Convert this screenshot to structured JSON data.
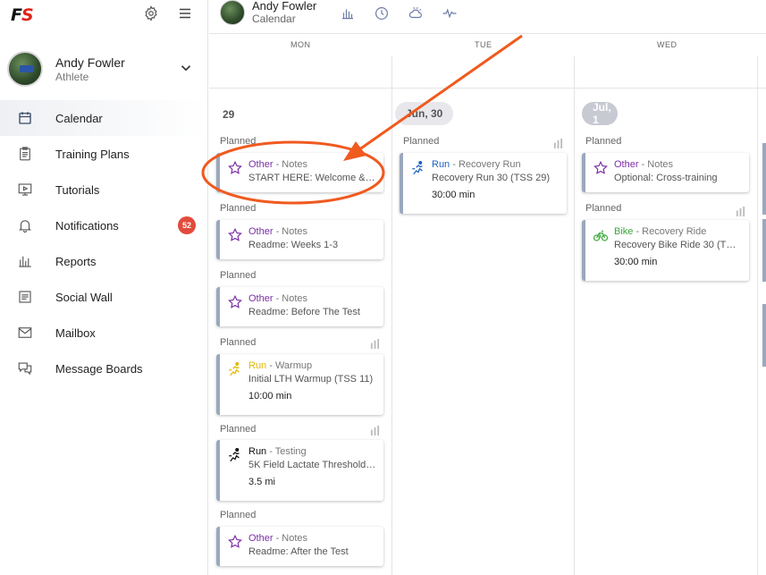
{
  "app": {
    "logo_f": "F",
    "logo_s": "S"
  },
  "profile": {
    "name": "Andy Fowler",
    "role": "Athlete"
  },
  "header": {
    "name": "Andy Fowler",
    "subtitle": "Calendar"
  },
  "nav": [
    {
      "label": "Calendar",
      "icon": "calendar-icon",
      "active": true
    },
    {
      "label": "Training Plans",
      "icon": "clipboard-icon"
    },
    {
      "label": "Tutorials",
      "icon": "video-icon"
    },
    {
      "label": "Notifications",
      "icon": "bell-icon",
      "badge": "52"
    },
    {
      "label": "Reports",
      "icon": "bar-chart-icon"
    },
    {
      "label": "Social Wall",
      "icon": "wall-icon"
    },
    {
      "label": "Mailbox",
      "icon": "mail-icon"
    },
    {
      "label": "Message Boards",
      "icon": "chat-icon"
    }
  ],
  "days": [
    "MON",
    "TUE",
    "WED"
  ],
  "dates": {
    "mon": "29",
    "tue": "Jun, 30",
    "wed": "Jul, 1"
  },
  "planned_label": "Planned",
  "colors": {
    "other": "#7b2fa5",
    "run_blue": "#1e62c6",
    "run_yellow": "#e5b800",
    "run_black": "#111111",
    "bike": "#3aa83a",
    "accent_arrow": "#f05a1f",
    "badge": "#e24b3b"
  },
  "mon_cards": [
    {
      "sport": "Other",
      "type": " - Notes",
      "desc": "START HERE: Welcome & S...",
      "duration": ""
    },
    {
      "sport": "Other",
      "type": " - Notes",
      "desc": "Readme: Weeks 1-3",
      "duration": ""
    },
    {
      "sport": "Other",
      "type": " - Notes",
      "desc": "Readme: Before The Test",
      "duration": ""
    },
    {
      "sport": "Run",
      "type": " - Warmup",
      "desc": "Initial LTH Warmup (TSS 11)",
      "duration_value": "10:00",
      "duration_unit": "min"
    },
    {
      "sport": "Run",
      "type": " - Testing",
      "desc": "5K Field Lactate Threshold ...",
      "duration_value": "3.5",
      "duration_unit": "mi"
    },
    {
      "sport": "Other",
      "type": " - Notes",
      "desc": "Readme: After the Test",
      "duration": ""
    }
  ],
  "tue_cards": [
    {
      "sport": "Run",
      "type": " - Recovery Run",
      "desc": "Recovery Run 30 (TSS 29)",
      "duration_value": "30:00",
      "duration_unit": "min"
    }
  ],
  "wed_cards": [
    {
      "sport": "Other",
      "type": " - Notes",
      "desc": "Optional: Cross-training"
    },
    {
      "sport": "Bike",
      "type": " - Recovery Ride",
      "desc": "Recovery Bike Ride 30 (TSS...",
      "duration_value": "30:00",
      "duration_unit": "min"
    }
  ]
}
